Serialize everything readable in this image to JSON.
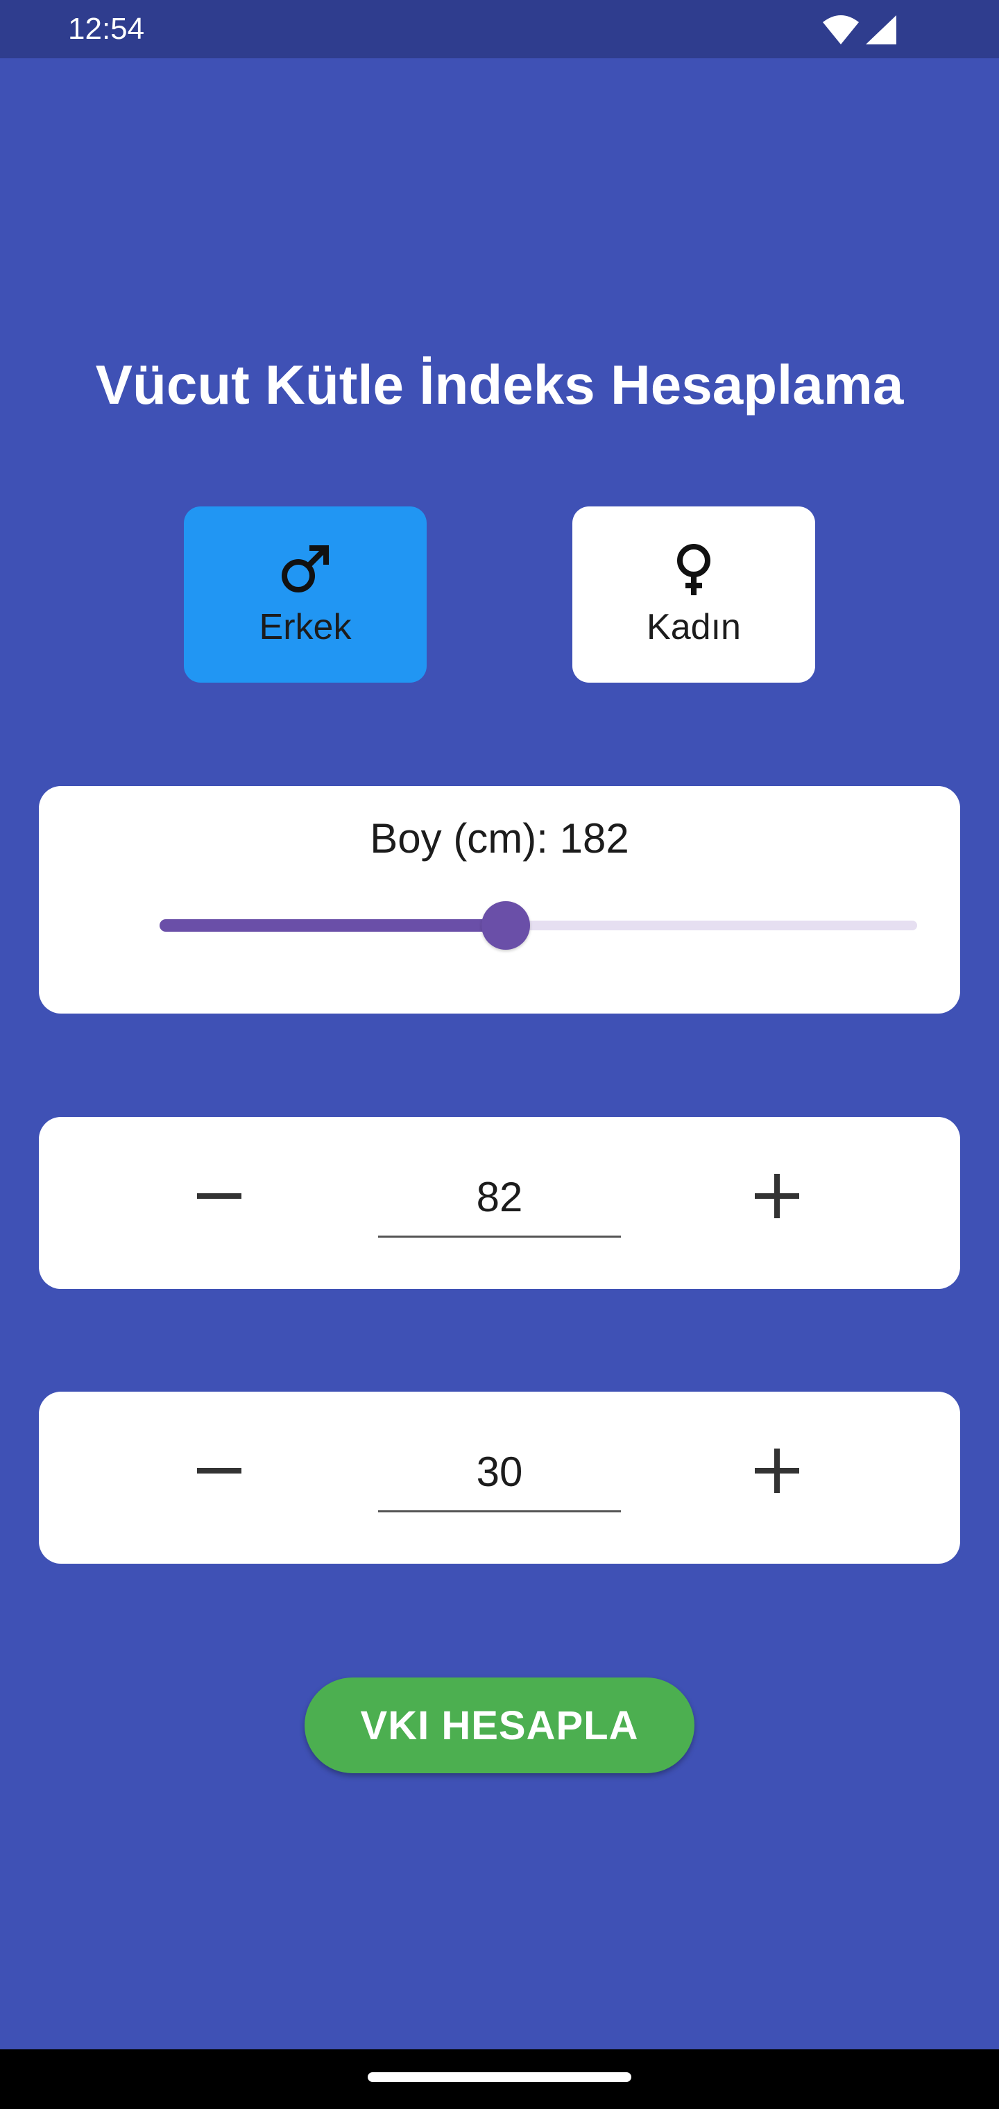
{
  "status_bar": {
    "time": "12:54",
    "icons": [
      "wifi-icon",
      "cellular-signal-icon"
    ]
  },
  "title": "Vücut Kütle İndeks Hesaplama",
  "gender": {
    "male": {
      "label": "Erkek",
      "icon": "male-symbol-icon",
      "selected": true,
      "color": "#2196f3"
    },
    "female": {
      "label": "Kadın",
      "icon": "female-symbol-icon",
      "selected": false,
      "color": "#ffffff"
    }
  },
  "height": {
    "label": "Boy (cm): 182",
    "value": 182,
    "slider_fraction": 0.457
  },
  "weight": {
    "value": "82",
    "minus_icon": "minus-icon",
    "plus_icon": "plus-icon"
  },
  "age": {
    "value": "30",
    "minus_icon": "minus-icon",
    "plus_icon": "plus-icon"
  },
  "calculate_button": {
    "label": "VKI HESAPLA",
    "color": "#4caf50"
  },
  "colors": {
    "background": "#3f51b5",
    "status_bar": "#2f3d8e",
    "slider_accent": "#6a4fa8"
  }
}
